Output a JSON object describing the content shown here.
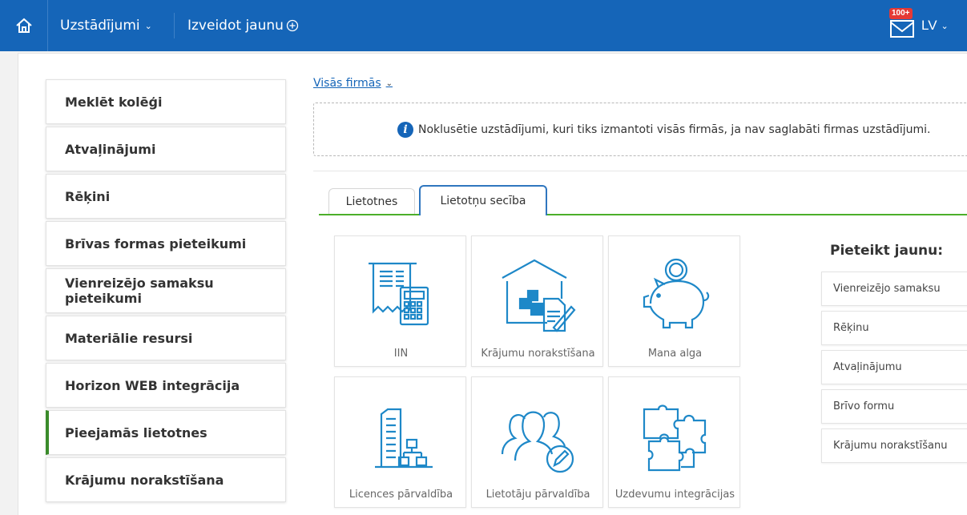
{
  "topbar": {
    "home_icon": "home-icon",
    "settings_label": "Uzstādījumi",
    "create_label": "Izveidot jaunu",
    "mail_badge": "100+",
    "language": "LV",
    "brand_color": "#1565b8"
  },
  "sidebar": {
    "items": [
      {
        "label": "Meklēt kolēģi"
      },
      {
        "label": "Atvaļinājumi"
      },
      {
        "label": "Rēķini"
      },
      {
        "label": "Brīvas formas pieteikumi"
      },
      {
        "label": "Vienreizējo samaksu pieteikumi"
      },
      {
        "label": "Materiālie resursi"
      },
      {
        "label": "Horizon WEB integrācija"
      },
      {
        "label": "Pieejamās lietotnes"
      },
      {
        "label": "Krājumu norakstīšana"
      }
    ],
    "active_index": 7,
    "active_color": "#3a8b2a"
  },
  "content": {
    "scope_label": "Visās firmās",
    "info_text": "Noklusētie uzstādījumi, kuri tiks izmantoti visās firmās, ja nav saglabāti firmas uzstādījumi.",
    "tabs": [
      {
        "label": "Lietotnes"
      },
      {
        "label": "Lietotņu secība"
      }
    ],
    "active_tab": 1,
    "tiles": [
      {
        "label": "IIN",
        "icon": "receipt-calculator-icon"
      },
      {
        "label": "Krājumu norakstīšana",
        "icon": "warehouse-document-icon"
      },
      {
        "label": "Mana alga",
        "icon": "piggy-bank-icon"
      },
      {
        "label": "Licences pārvaldība",
        "icon": "building-hierarchy-icon"
      },
      {
        "label": "Lietotāju pārvaldība",
        "icon": "users-edit-icon"
      },
      {
        "label": "Uzdevumu integrācijas",
        "icon": "puzzle-icon"
      }
    ],
    "new_request": {
      "title": "Pieteikt jaunu:",
      "items": [
        {
          "label": "Vienreizējo samaksu"
        },
        {
          "label": "Rēķinu"
        },
        {
          "label": "Atvaļinājumu"
        },
        {
          "label": "Brīvo formu"
        },
        {
          "label": "Krājumu norakstīšanu"
        }
      ]
    }
  }
}
